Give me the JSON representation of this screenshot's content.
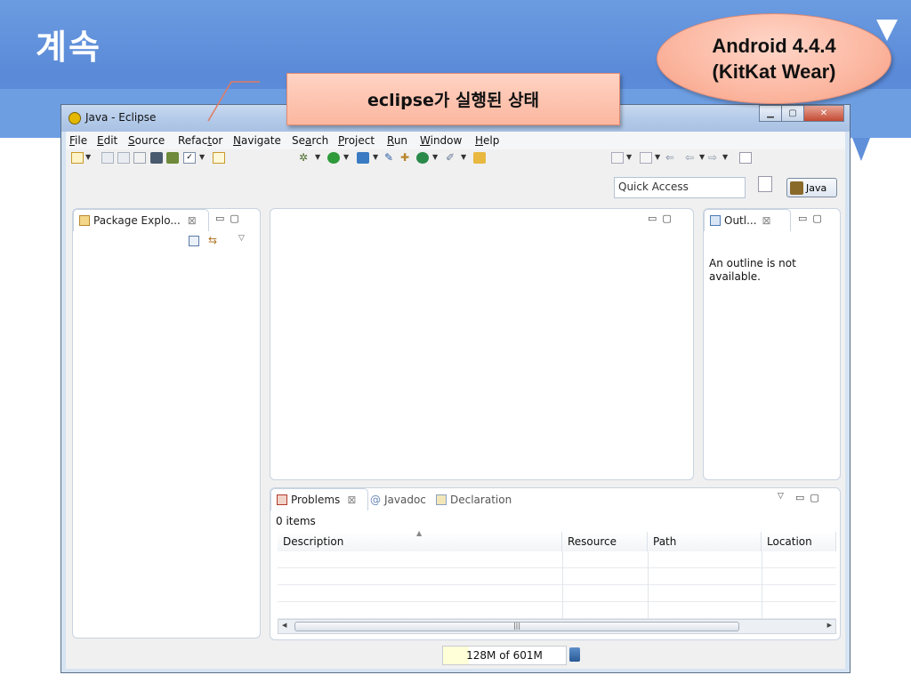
{
  "slide": {
    "title": "계속",
    "oval_label": "Android 4.4.4\n(KitKat Wear)",
    "callout_label": "eclipse가 실행된 상태"
  },
  "window": {
    "title": "Java - Eclipse",
    "buttons": [
      "minimize",
      "maximize",
      "close"
    ]
  },
  "menu": [
    {
      "mnemonic": "F",
      "rest": "ile"
    },
    {
      "mnemonic": "E",
      "rest": "dit"
    },
    {
      "mnemonic": "S",
      "rest": "ource"
    },
    {
      "pre": "Refac",
      "mnemonic": "t",
      "rest": "or"
    },
    {
      "mnemonic": "N",
      "rest": "avigate"
    },
    {
      "pre": "Se",
      "mnemonic": "a",
      "rest": "rch"
    },
    {
      "mnemonic": "P",
      "rest": "roject"
    },
    {
      "mnemonic": "R",
      "rest": "un"
    },
    {
      "mnemonic": "W",
      "rest": "indow"
    },
    {
      "mnemonic": "H",
      "rest": "elp"
    }
  ],
  "quick_access": {
    "placeholder": "Quick Access"
  },
  "perspective": {
    "label": "Java"
  },
  "package_explorer": {
    "tab_label": "Package Explo..."
  },
  "outline": {
    "tab_label": "Outl...",
    "message": "An outline is not available."
  },
  "bottom_panel": {
    "tabs": [
      {
        "label": "Problems",
        "selected": true
      },
      {
        "label": "Javadoc",
        "selected": false
      },
      {
        "label": "Declaration",
        "selected": false
      }
    ],
    "item_count": "0 items",
    "columns": [
      "Description",
      "Resource",
      "Path",
      "Location"
    ]
  },
  "status": {
    "heap_label": "128M of 601M",
    "heap_fraction": 0.21
  },
  "colors": {
    "callout_fill": "#fbb7a0",
    "band": "#6b9be0",
    "window_frame": "#d6e3f2"
  }
}
